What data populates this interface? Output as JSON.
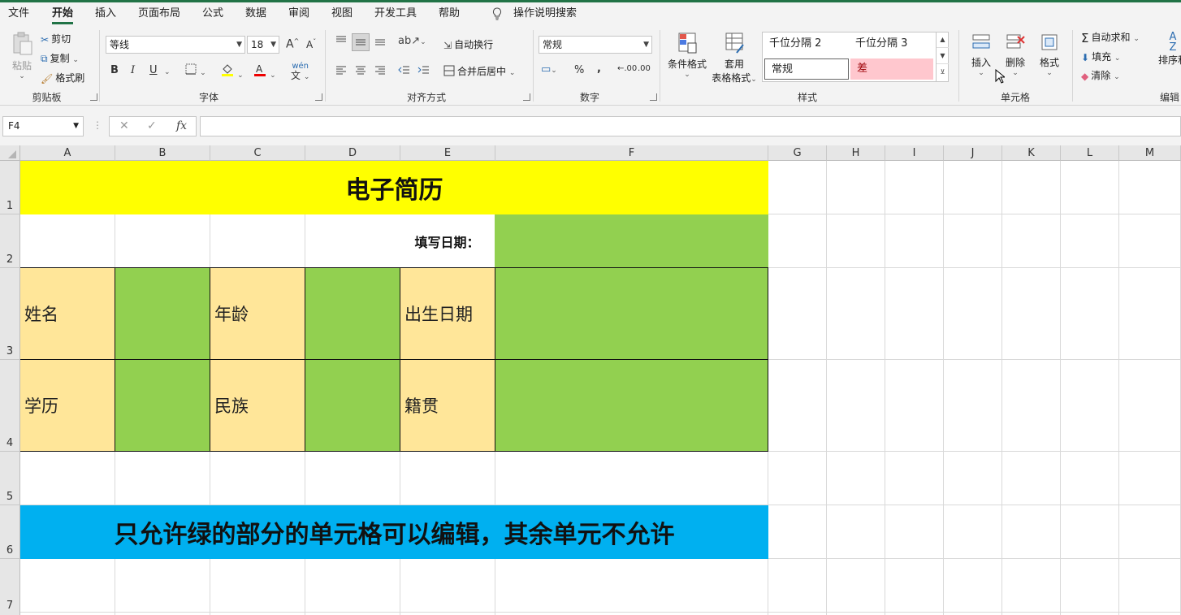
{
  "ribbon_tabs": [
    "文件",
    "开始",
    "插入",
    "页面布局",
    "公式",
    "数据",
    "审阅",
    "视图",
    "开发工具",
    "帮助"
  ],
  "active_tab": "开始",
  "tell_me": "操作说明搜索",
  "clipboard": {
    "paste": "粘贴",
    "cut": "剪切",
    "copy": "复制",
    "format_painter": "格式刷",
    "label": "剪贴板"
  },
  "font": {
    "name": "等线",
    "size": "18",
    "label": "字体",
    "bold": "B",
    "italic": "I",
    "underline": "U",
    "grow": "A",
    "shrink": "A",
    "phonetic": "wén"
  },
  "alignment": {
    "wrap": "自动换行",
    "merge": "合并后居中",
    "label": "对齐方式"
  },
  "number": {
    "format": "常规",
    "percent": "%",
    "comma": ",",
    "label": "数字"
  },
  "styles": {
    "conditional": "条件格式",
    "table_format_1": "套用",
    "table_format_2": "表格格式",
    "cells": [
      "千位分隔 2",
      "千位分隔 3",
      "常规",
      "差"
    ],
    "label": "样式"
  },
  "cells_group": {
    "insert": "插入",
    "delete": "删除",
    "format": "格式",
    "label": "单元格"
  },
  "editing": {
    "autosum": "自动求和",
    "fill": "填充",
    "clear": "清除",
    "sort": "排序和",
    "label": "编辑"
  },
  "formula_bar": {
    "name_box": "F4",
    "cancel": "✕",
    "enter": "✓",
    "fx": "fx",
    "content": ""
  },
  "columns": [
    "A",
    "B",
    "C",
    "D",
    "E",
    "F",
    "G",
    "H",
    "I",
    "J",
    "K",
    "L",
    "M"
  ],
  "rows": [
    "1",
    "2",
    "3",
    "4",
    "5",
    "6",
    "7"
  ],
  "sheet": {
    "title": "电子简历",
    "fill_date_label": "填写日期：",
    "name_label": "姓名",
    "age_label": "年龄",
    "birth_label": "出生日期",
    "edu_label": "学历",
    "ethnic_label": "民族",
    "origin_label": "籍贯",
    "notice": "只允许绿的部分的单元格可以编辑，其余单元不允许"
  },
  "colors": {
    "title_fill": "#FFFF00",
    "label_fill": "#FFE699",
    "input_fill": "#92D050",
    "notice_fill": "#00B0F0",
    "accent": "#217346"
  }
}
